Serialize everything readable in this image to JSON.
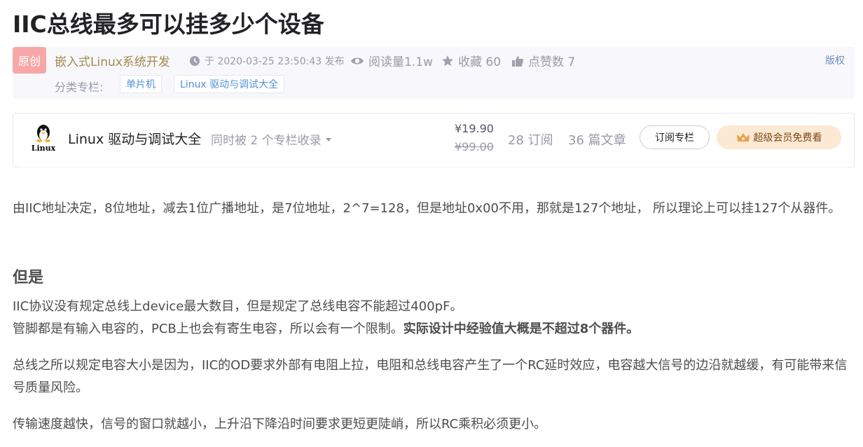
{
  "article": {
    "title": "IIC总线最多可以挂多少个设备"
  },
  "meta": {
    "badge": "原创",
    "author": "嵌入式Linux系统开发",
    "published": "于 2020-03-25 23:50:43 发布",
    "reads": "阅读量1.1w",
    "favorites": "收藏 60",
    "likes": "点赞数 7",
    "copyright": "版权",
    "category_label": "分类专栏:",
    "tags": [
      "单片机",
      "Linux 驱动与调试大全"
    ]
  },
  "column": {
    "logo_text": "Linux",
    "name": "Linux 驱动与调试大全",
    "also_in": "同时被 2 个专栏收录",
    "price": "¥19.90",
    "original_price": "¥99.00",
    "subscribers": "28 订阅",
    "article_count": "36 篇文章",
    "subscribe_button": "订阅专栏",
    "vip_button": "超级会员免费看"
  },
  "body": {
    "p1": "由IIC地址决定，8位地址，减去1位广播地址，是7位地址，2^7=128，但是地址0x00不用，那就是127个地址， 所以理论上可以挂127个从器件。",
    "heading": "但是",
    "p2_line1": "IIC协议没有规定总线上device最大数目，但是规定了总线电容不能超过400pF。",
    "p2_line2": "管脚都是有输入电容的，PCB上也会有寄生电容，所以会有一个限制。",
    "p2_bold": "实际设计中经验值大概是不超过8个器件。",
    "p3": "总线之所以规定电容大小是因为，IIC的OD要求外部有电阻上拉，电阻和总线电容产生了一个RC延时效应，电容越大信号的边沿就越缓，有可能带来信号质量风险。",
    "p4": "传输速度越快，信号的窗口就越小，上升沿下降沿时间要求更短更陡峭，所以RC乘积必须更小。"
  },
  "colors": {
    "author": "#a48a4b",
    "badge_bg": "#f7a7a7",
    "tag_text": "#5094d5",
    "vip_bg": "#fce9d3"
  }
}
